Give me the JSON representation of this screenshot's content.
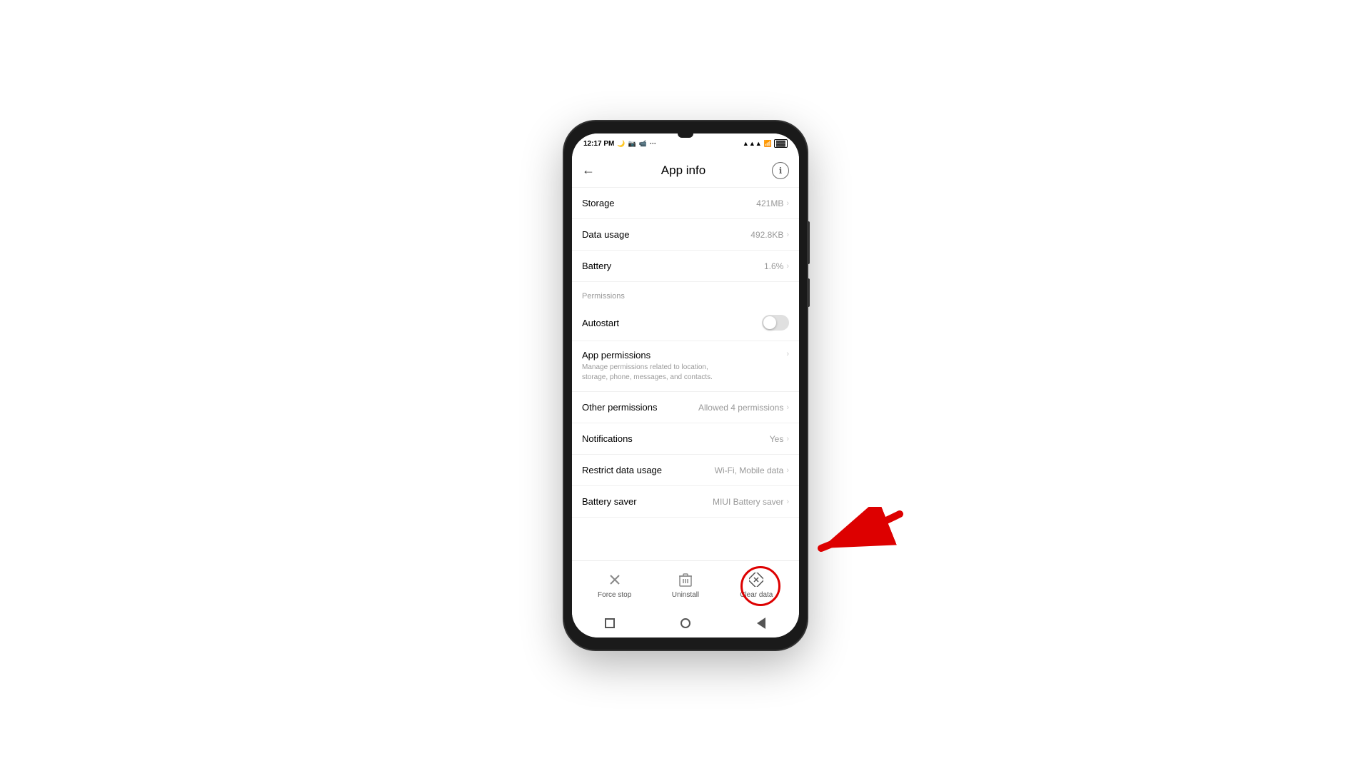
{
  "statusBar": {
    "time": "12:17 PM",
    "icons": [
      "moon",
      "camera",
      "video",
      "dots"
    ]
  },
  "header": {
    "title": "App info",
    "backLabel": "←",
    "infoLabel": "ℹ"
  },
  "rows": [
    {
      "label": "Storage",
      "value": "421MB",
      "hasChevron": true
    },
    {
      "label": "Data usage",
      "value": "492.8KB",
      "hasChevron": true
    },
    {
      "label": "Battery",
      "value": "1.6%",
      "hasChevron": true
    }
  ],
  "permissionsSection": {
    "header": "Permissions",
    "autostart": {
      "label": "Autostart",
      "enabled": false
    },
    "appPermissions": {
      "title": "App permissions",
      "subtitle": "Manage permissions related to location, storage, phone, messages, and contacts.",
      "hasChevron": true
    },
    "otherPermissions": {
      "label": "Other permissions",
      "value": "Allowed 4 permissions",
      "hasChevron": true
    },
    "notifications": {
      "label": "Notifications",
      "value": "Yes",
      "hasChevron": true
    },
    "restrictDataUsage": {
      "label": "Restrict data usage",
      "value": "Wi-Fi, Mobile data",
      "hasChevron": true
    },
    "batterySaver": {
      "label": "Battery saver",
      "value": "MIUI Battery saver",
      "hasChevron": true
    }
  },
  "bottomBar": {
    "forceStop": "Force stop",
    "uninstall": "Uninstall",
    "clearData": "Clear data"
  },
  "navBar": {
    "square": "■",
    "circle": "○",
    "triangle": "◄"
  }
}
